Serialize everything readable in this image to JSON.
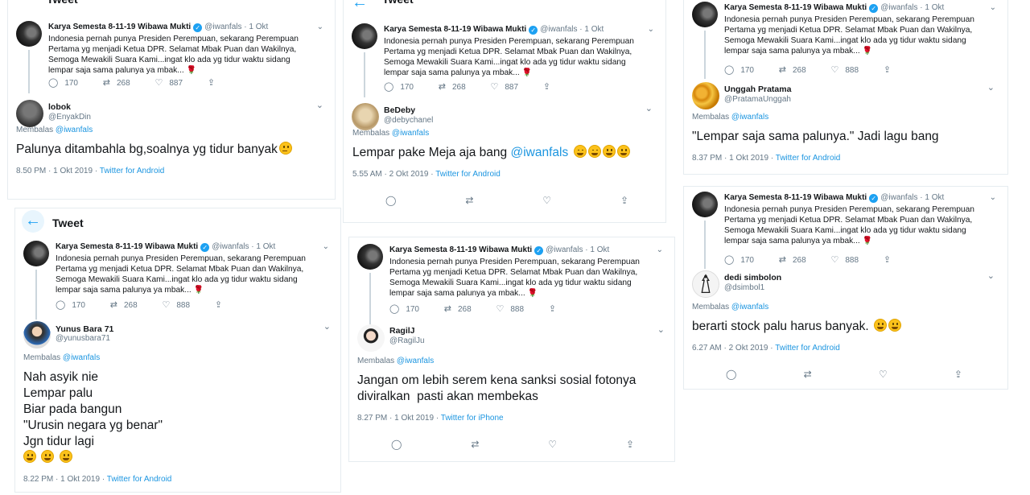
{
  "header_title": "Tweet",
  "icons": {
    "back": "←",
    "caret": "⌄",
    "reply": "◯",
    "retweet": "⇄",
    "like": "♡",
    "share": "⇪",
    "verified": "✓",
    "rose": "🌹"
  },
  "parent_tweet": {
    "name": "Karya Semesta 8-11-19 Wibawa Mukti",
    "handle": "@iwanfals",
    "date": "1 Okt",
    "dot": "·",
    "text": "Indonesia pernah punya Presiden Perempuan, sekarang Perempuan Pertama yg menjadi Ketua DPR. Selamat Mbak Puan dan Wakilnya, Semoga Mewakili Suara Kami...ingat klo ada yg tidur waktu sidang lempar saja sama palunya ya mbak...",
    "replies": "170",
    "retweets": "268"
  },
  "replying_label": "Membalas",
  "replying_handle": "@iwanfals",
  "cards": [
    {
      "likes": "887",
      "reply": {
        "name": "lobok",
        "handle": "@EnyakDin",
        "text": "Palunya ditambahla bg,soalnya yg tidur banyak",
        "time": "8.50 PM · 1 Okt 2019 · ",
        "source": "Twitter for Android"
      }
    },
    {
      "likes": "887",
      "reply": {
        "name": "BeDeby",
        "handle": "@debychanel",
        "text": "Lempar pake Meja aja bang ",
        "mention": "@iwanfals",
        "time": "5.55 AM · 2 Okt 2019 · ",
        "source": "Twitter for Android"
      }
    },
    {
      "likes": "888",
      "reply": {
        "name": "Unggah Pratama",
        "handle": "@PratamaUnggah",
        "text": "\"Lempar saja sama palunya.\" Jadi lagu bang",
        "time": "8.37 PM · 1 Okt 2019 · ",
        "source": "Twitter for Android"
      }
    },
    {
      "likes": "888",
      "reply": {
        "name": "Yunus Bara 71",
        "handle": "@yunusbara71",
        "lines": [
          "Nah asyik nie",
          "Lempar palu",
          "Biar pada bangun",
          "\"Urusin negara yg benar\"",
          "Jgn tidur lagi"
        ],
        "time": "8.22 PM · 1 Okt 2019 · ",
        "source": "Twitter for Android"
      }
    },
    {
      "likes": "888",
      "reply": {
        "name": "RagilJ",
        "handle": "@RagilJu",
        "lines": [
          "Jangan om lebih serem kena sanksi sosial fotonya",
          "diviralkan  pasti akan membekas"
        ],
        "time": "8.27 PM · 1 Okt 2019 · ",
        "source": "Twitter for iPhone"
      }
    },
    {
      "likes": "888",
      "reply": {
        "name": "dedi simbolon",
        "handle": "@dsimbol1",
        "text": "berarti stock palu harus banyak.",
        "time": "6.27 AM · 2 Okt 2019 · ",
        "source": "Twitter for Android"
      }
    }
  ]
}
